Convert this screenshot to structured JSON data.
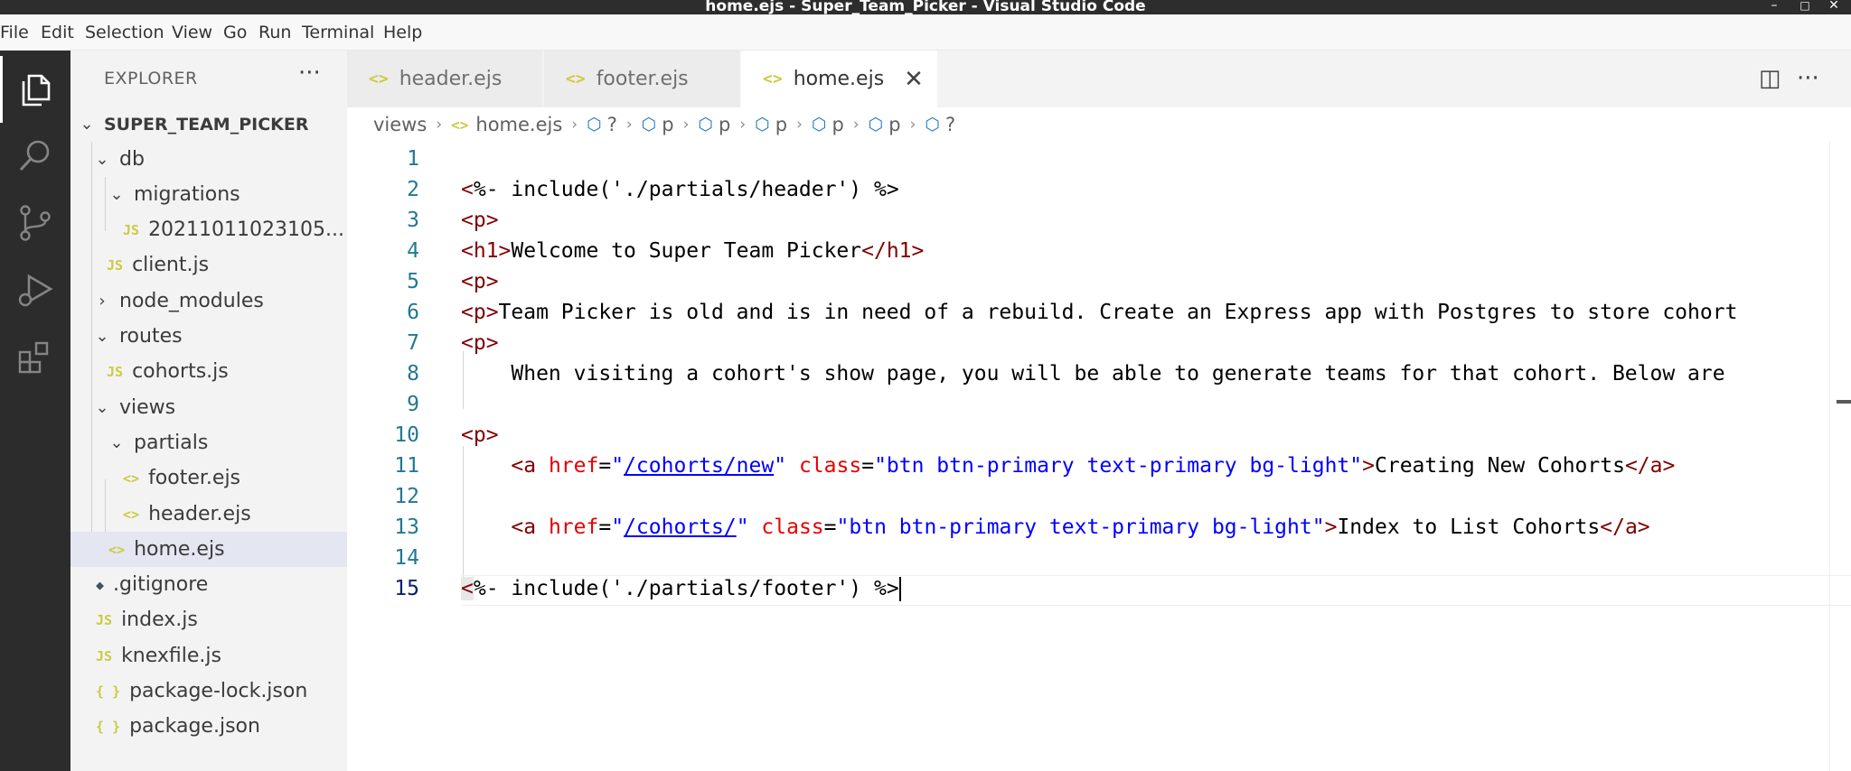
{
  "window": {
    "title": "home.ejs - Super_Team_Picker - Visual Studio Code",
    "minimize": "–",
    "maximize": "□",
    "close": "✕"
  },
  "menu": [
    "File",
    "Edit",
    "Selection",
    "View",
    "Go",
    "Run",
    "Terminal",
    "Help"
  ],
  "activity_bar": [
    "files-icon",
    "search-icon",
    "source-control-icon",
    "run-debug-icon",
    "extensions-icon"
  ],
  "sidebar": {
    "title": "EXPLORER",
    "more": "···",
    "root": "SUPER_TEAM_PICKER",
    "items": [
      {
        "label": "db",
        "kind": "folder-open"
      },
      {
        "label": "migrations",
        "kind": "folder-open"
      },
      {
        "label": "20211011023105...",
        "kind": "js"
      },
      {
        "label": "client.js",
        "kind": "js"
      },
      {
        "label": "node_modules",
        "kind": "folder-closed"
      },
      {
        "label": "routes",
        "kind": "folder-open"
      },
      {
        "label": "cohorts.js",
        "kind": "js"
      },
      {
        "label": "views",
        "kind": "folder-open"
      },
      {
        "label": "partials",
        "kind": "folder-open"
      },
      {
        "label": "footer.ejs",
        "kind": "ejs"
      },
      {
        "label": "header.ejs",
        "kind": "ejs"
      },
      {
        "label": "home.ejs",
        "kind": "ejs",
        "selected": true
      },
      {
        "label": ".gitignore",
        "kind": "git"
      },
      {
        "label": "index.js",
        "kind": "js"
      },
      {
        "label": "knexfile.js",
        "kind": "js"
      },
      {
        "label": "package-lock.json",
        "kind": "json"
      },
      {
        "label": "package.json",
        "kind": "json"
      }
    ],
    "icons": {
      "js": "JS",
      "ejs": "<>",
      "json": "{ }",
      "git": "◆"
    }
  },
  "tabs": [
    {
      "label": "header.ejs",
      "active": false
    },
    {
      "label": "footer.ejs",
      "active": false
    },
    {
      "label": "home.ejs",
      "active": true
    }
  ],
  "tab_close": "✕",
  "editor_actions": {
    "split": "◫",
    "more": "···"
  },
  "breadcrumb": {
    "folder": "views",
    "file": "home.ejs",
    "symbols": [
      "?",
      "p",
      "p",
      "p",
      "p",
      "p",
      "?"
    ]
  },
  "editor": {
    "current_line": 15,
    "line_numbers": [
      "1",
      "2",
      "3",
      "4",
      "5",
      "6",
      "7",
      "8",
      "9",
      "10",
      "11",
      "12",
      "13",
      "14",
      "15"
    ],
    "lines": {
      "l2": "%- include('./partials/header') %>",
      "l4_tag_open": "<h1>",
      "l4_text": "Welcome to Super Team Picker",
      "l4_tag_close": "</h1>",
      "p_tag": "<p>",
      "l6_text": "Team Picker is old and is in need of a rebuild. Create an Express app with Postgres to store cohort",
      "l8_text": "When visiting a cohort's show page, you will be able to generate teams for that cohort. Below are",
      "a_open": "<a",
      "href_attr": "href",
      "class_attr": "class",
      "l11_href": "/cohorts/new",
      "l13_href": "/cohorts/",
      "class_val": "btn btn-primary text-primary bg-light",
      "l11_text": "Creating New Cohorts",
      "l13_text": "Index to List Cohorts",
      "a_close": "</a>",
      "l15": "%- include('./partials/footer') %>"
    }
  }
}
